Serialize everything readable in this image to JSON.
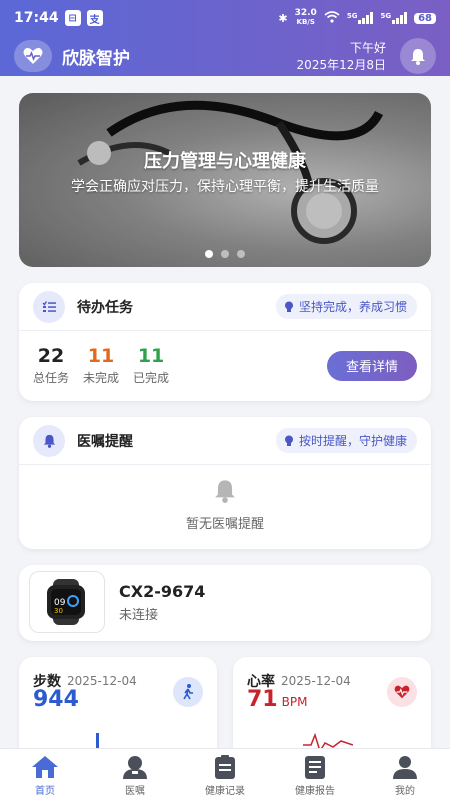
{
  "status_bar": {
    "time": "17:44",
    "speed": "32.0",
    "speed_unit": "KB/S",
    "battery": "68",
    "net1": "5G",
    "net2": "5G"
  },
  "header": {
    "app_title": "欣脉智护",
    "greeting": "下午好",
    "date": "2025年12月8日",
    "logo_icon": "heart-pulse-icon",
    "bell_icon": "bell-icon"
  },
  "banner": {
    "title": "压力管理与心理健康",
    "subtitle": "学会正确应对压力，保持心理平衡，提升生活质量",
    "active_slide": 1,
    "slide_count": 3
  },
  "todo": {
    "title": "待办任务",
    "tip": "坚持完成，养成习惯",
    "stats": [
      {
        "value": "22",
        "label": "总任务",
        "color": "#222222"
      },
      {
        "value": "11",
        "label": "未完成",
        "color": "#e06a1b"
      },
      {
        "value": "11",
        "label": "已完成",
        "color": "#2fa24e"
      }
    ],
    "button": "查看详情"
  },
  "advice": {
    "title": "医嘱提醒",
    "tip": "按时提醒，守护健康",
    "empty_text": "暂无医嘱提醒"
  },
  "device": {
    "name": "CX2-9674",
    "status": "未连接"
  },
  "steps": {
    "label": "步数",
    "date": "2025-12-04",
    "value": "944",
    "color": "#2c5bd0"
  },
  "heart_rate": {
    "label": "心率",
    "date": "2025-12-04",
    "value": "71",
    "unit": "BPM",
    "color": "#c8232c"
  },
  "tabs": [
    {
      "label": "首页",
      "icon": "home-icon",
      "active": true
    },
    {
      "label": "医嘱",
      "icon": "doctor-icon",
      "active": false
    },
    {
      "label": "健康记录",
      "icon": "clipboard-icon",
      "active": false
    },
    {
      "label": "健康报告",
      "icon": "report-icon",
      "active": false
    },
    {
      "label": "我的",
      "icon": "user-icon",
      "active": false
    }
  ],
  "colors": {
    "accent": "#5b68d6",
    "accent2": "#7a5fc4",
    "tip_text": "#4a57c4"
  }
}
